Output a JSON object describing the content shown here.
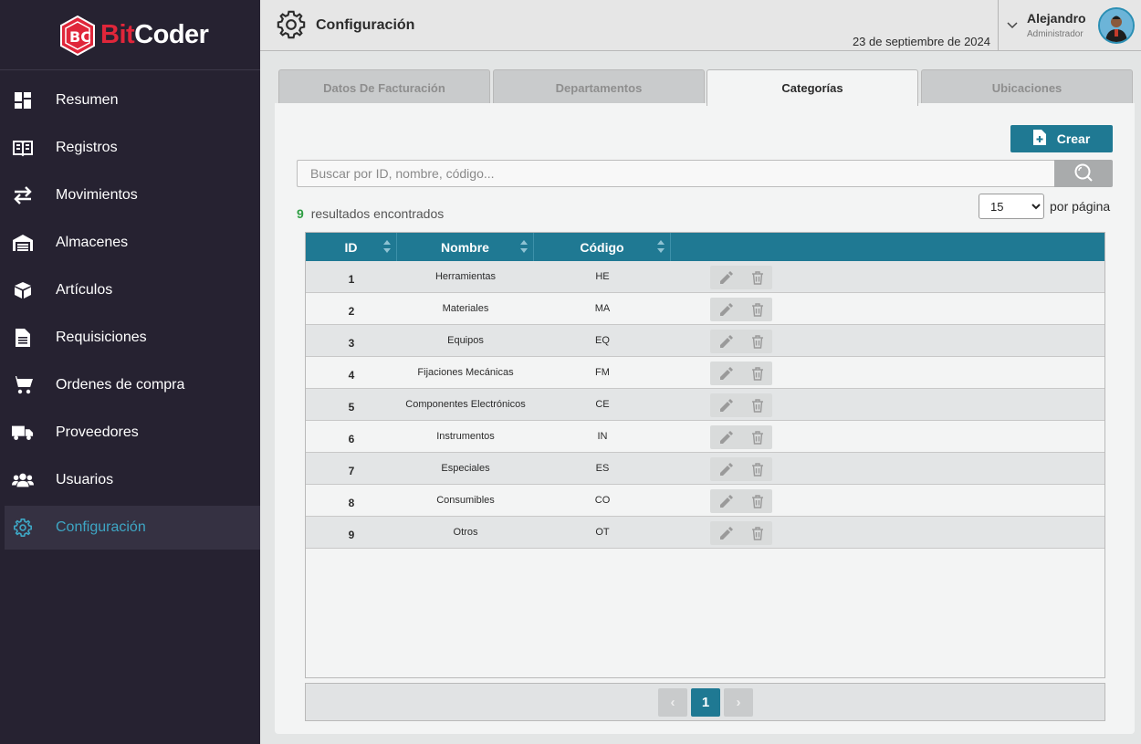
{
  "brand": {
    "prefix": "Bit",
    "suffix": "Coder",
    "accent": "#e0263a"
  },
  "sidebar": {
    "items": [
      {
        "label": "Resumen",
        "icon": "dashboard-icon"
      },
      {
        "label": "Registros",
        "icon": "book-icon"
      },
      {
        "label": "Movimientos",
        "icon": "arrows-icon"
      },
      {
        "label": "Almacenes",
        "icon": "warehouse-icon"
      },
      {
        "label": "Artículos",
        "icon": "box-icon"
      },
      {
        "label": "Requisiciones",
        "icon": "document-icon"
      },
      {
        "label": "Ordenes de compra",
        "icon": "cart-icon"
      },
      {
        "label": "Proveedores",
        "icon": "truck-icon"
      },
      {
        "label": "Usuarios",
        "icon": "users-icon"
      },
      {
        "label": "Configuración",
        "icon": "gear-icon",
        "active": true
      }
    ]
  },
  "header": {
    "title": "Configuración",
    "date": "23 de septiembre de 2024",
    "user_name": "Alejandro",
    "user_role": "Administrador"
  },
  "tabs": [
    {
      "label": "Datos De Facturación"
    },
    {
      "label": "Departamentos"
    },
    {
      "label": "Categorías",
      "active": true
    },
    {
      "label": "Ubicaciones"
    }
  ],
  "toolbar": {
    "create_label": "Crear",
    "search_placeholder": "Buscar por ID, nombre, código...",
    "results_count": "9",
    "results_label": "resultados encontrados",
    "per_page_value": "15",
    "per_page_label": "por página"
  },
  "table": {
    "columns": [
      "ID",
      "Nombre",
      "Código"
    ],
    "rows": [
      {
        "id": "1",
        "name": "Herramientas",
        "code": "HE"
      },
      {
        "id": "2",
        "name": "Materiales",
        "code": "MA"
      },
      {
        "id": "3",
        "name": "Equipos",
        "code": "EQ"
      },
      {
        "id": "4",
        "name": "Fijaciones Mecánicas",
        "code": "FM"
      },
      {
        "id": "5",
        "name": "Componentes Electrónicos",
        "code": "CE"
      },
      {
        "id": "6",
        "name": "Instrumentos",
        "code": "IN"
      },
      {
        "id": "7",
        "name": "Especiales",
        "code": "ES"
      },
      {
        "id": "8",
        "name": "Consumibles",
        "code": "CO"
      },
      {
        "id": "9",
        "name": "Otros",
        "code": "OT"
      }
    ]
  },
  "pagination": {
    "prev": "‹",
    "current": "1",
    "next": "›"
  },
  "colors": {
    "primary": "#1f7993",
    "sidebar_bg": "#262231",
    "active_text": "#3ea6c4",
    "count_green": "#2e9e43"
  }
}
